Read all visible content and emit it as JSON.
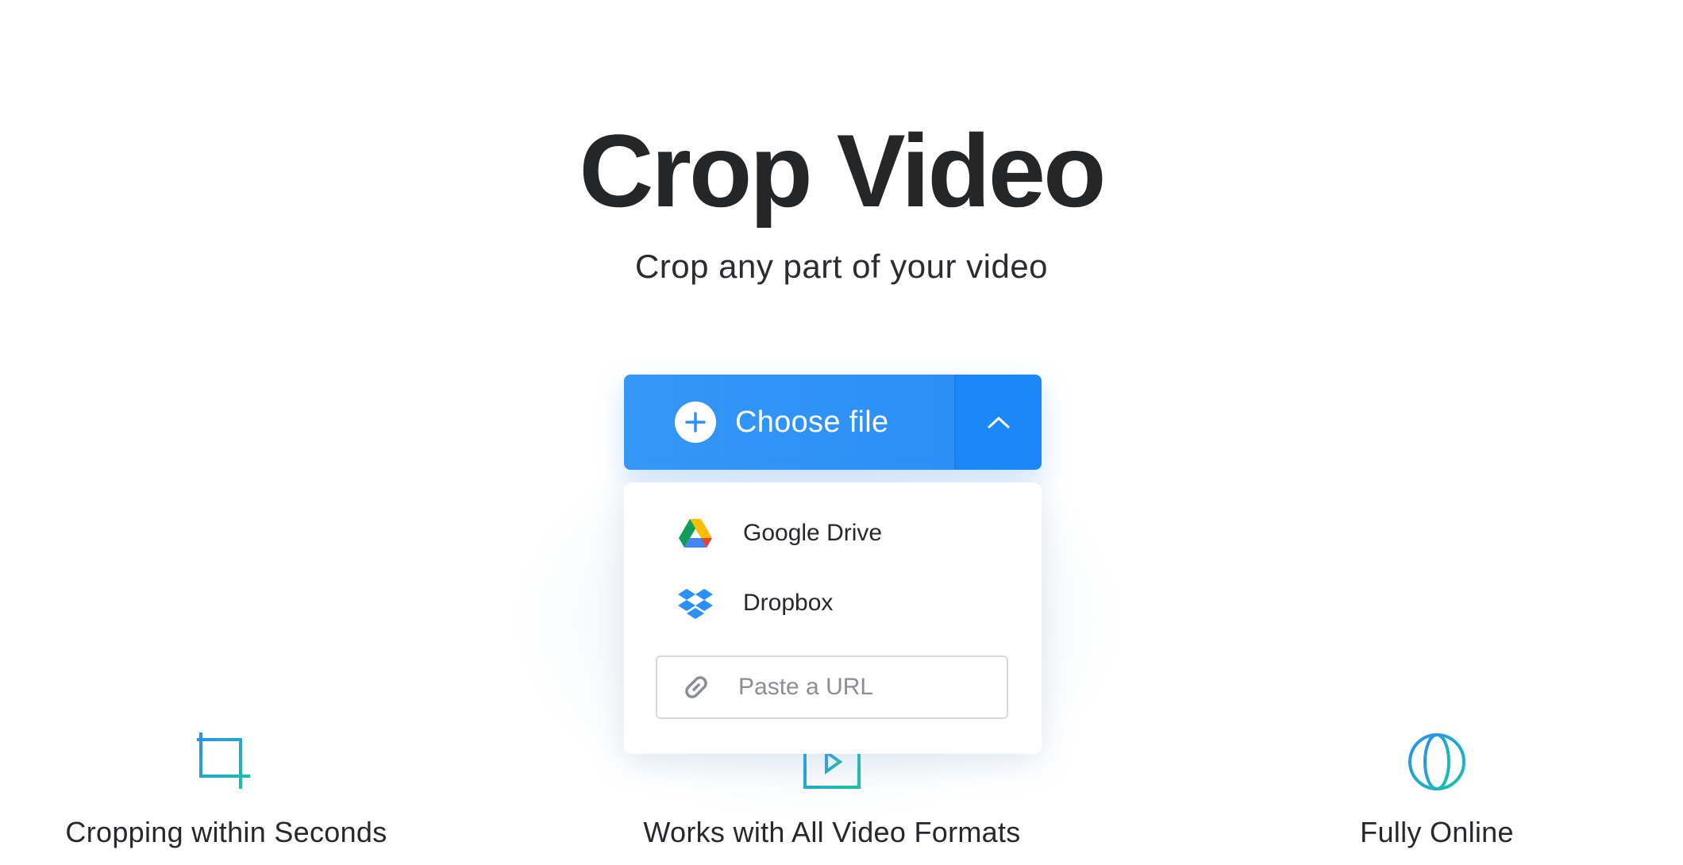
{
  "header": {
    "title": "Crop Video",
    "subtitle": "Crop any part of your video"
  },
  "upload": {
    "choose_label": "Choose file",
    "accent_color": "#2b8ff8",
    "dropdown": {
      "items": [
        {
          "label": "Google Drive",
          "icon": "google-drive-icon"
        },
        {
          "label": "Dropbox",
          "icon": "dropbox-icon"
        }
      ],
      "url_placeholder": "Paste a URL",
      "url_icon": "link-icon"
    }
  },
  "features": [
    {
      "label": "Cropping within Seconds",
      "icon": "crop-icon"
    },
    {
      "label": "Works with All Video Formats",
      "icon": "video-format-icon"
    },
    {
      "label": "Fully Online",
      "icon": "globe-icon"
    }
  ]
}
